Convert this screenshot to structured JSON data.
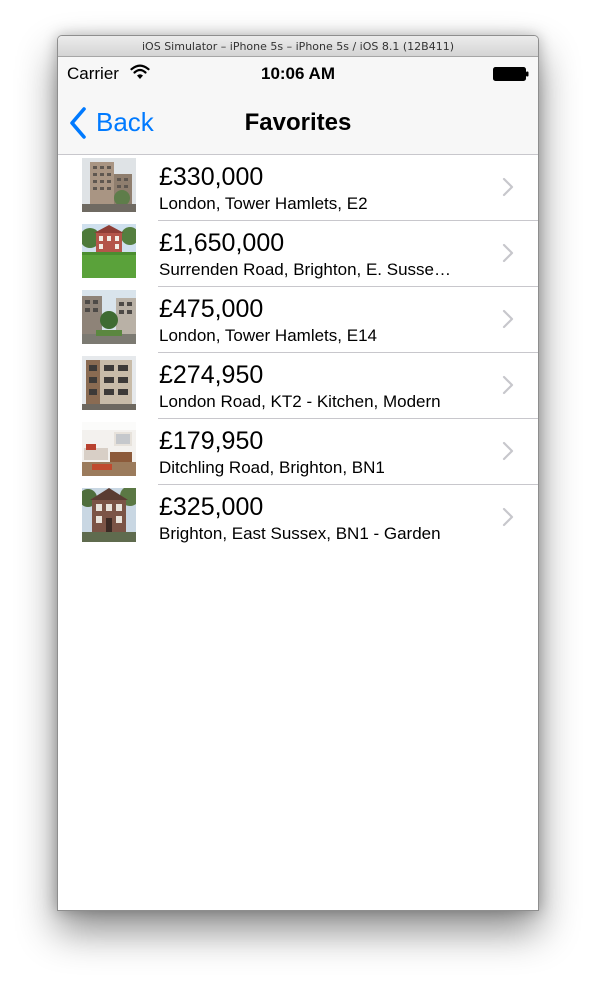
{
  "simulator": {
    "title": "iOS Simulator – iPhone 5s – iPhone 5s / iOS 8.1 (12B411)"
  },
  "status_bar": {
    "carrier": "Carrier",
    "time": "10:06 AM",
    "icons": [
      "wifi-icon",
      "battery-icon"
    ]
  },
  "nav_bar": {
    "back_label": "Back",
    "title": "Favorites",
    "accent_color": "#007aff"
  },
  "listings": [
    {
      "price": "£330,000",
      "address": "London, Tower Hamlets, E2",
      "thumbnail": "tower-block-photo"
    },
    {
      "price": "£1,650,000",
      "address": "Surrenden Road, Brighton, E. Susse…",
      "thumbnail": "house-with-lawn-photo"
    },
    {
      "price": "£475,000",
      "address": "London, Tower Hamlets, E14",
      "thumbnail": "apartment-courtyard-photo"
    },
    {
      "price": "£274,950",
      "address": "London Road, KT2 - Kitchen, Modern",
      "thumbnail": "modern-flats-photo"
    },
    {
      "price": "£179,950",
      "address": "Ditchling Road, Brighton, BN1",
      "thumbnail": "living-room-photo"
    },
    {
      "price": "£325,000",
      "address": "Brighton, East Sussex, BN1 - Garden",
      "thumbnail": "victorian-house-photo"
    }
  ]
}
